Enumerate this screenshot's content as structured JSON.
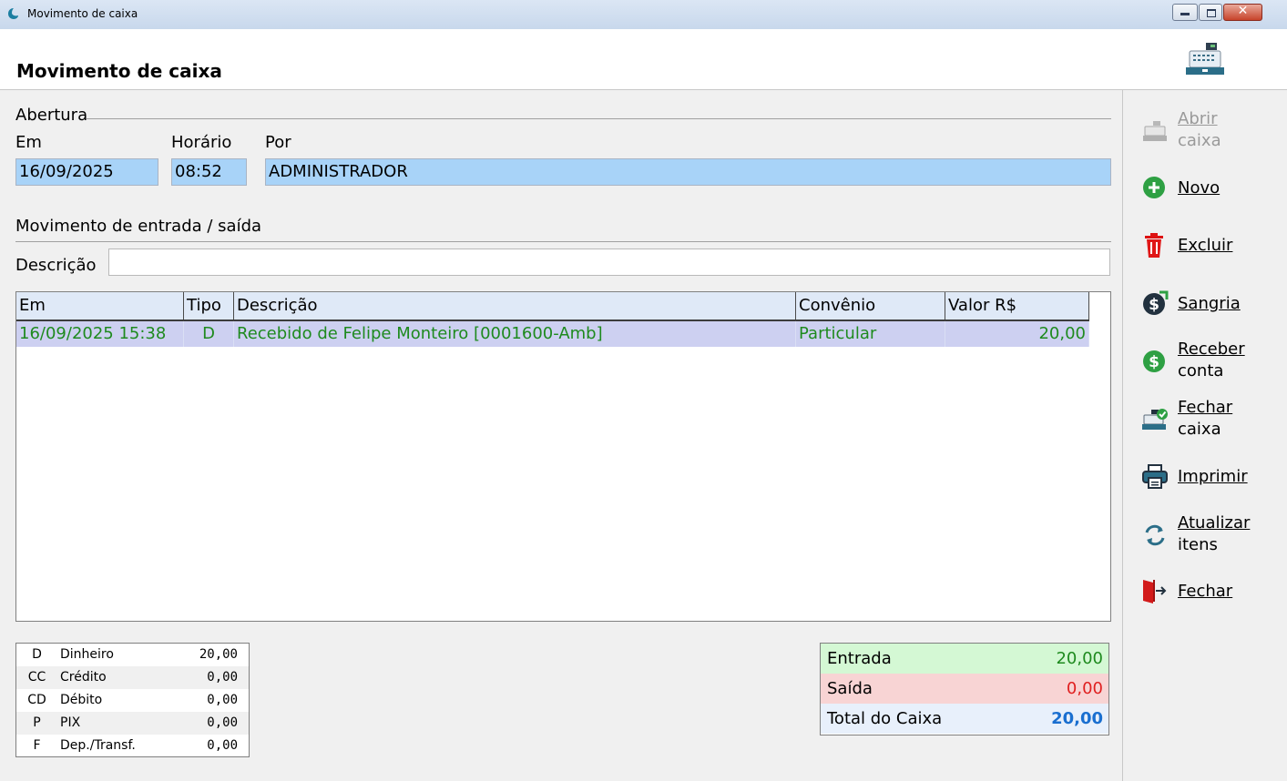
{
  "window": {
    "title": "Movimento de caixa"
  },
  "header": {
    "title": "Movimento de caixa"
  },
  "abertura": {
    "section_label": "Abertura",
    "em_label": "Em",
    "horario_label": "Horário",
    "por_label": "Por",
    "em_value": "16/09/2025",
    "horario_value": "08:52",
    "por_value": "ADMINISTRADOR"
  },
  "movimento": {
    "section_label": "Movimento de entrada / saída",
    "descricao_label": "Descrição",
    "descricao_value": ""
  },
  "grid": {
    "columns": [
      "Em",
      "Tipo",
      "Descrição",
      "Convênio",
      "Valor R$"
    ],
    "rows": [
      {
        "em": "16/09/2025  15:38",
        "tipo": "D",
        "descricao": "Recebido de Felipe Monteiro [0001600-Amb]",
        "convenio": "Particular",
        "valor": "20,00"
      }
    ],
    "row_text_color": "#1e8a1e",
    "row_bg_color": "#cdd0f1"
  },
  "payments": [
    {
      "code": "D",
      "name": "Dinheiro",
      "value": "20,00"
    },
    {
      "code": "CC",
      "name": "Crédito",
      "value": "0,00"
    },
    {
      "code": "CD",
      "name": "Débito",
      "value": "0,00"
    },
    {
      "code": "P",
      "name": "PIX",
      "value": "0,00"
    },
    {
      "code": "F",
      "name": "Dep./Transf.",
      "value": "0,00"
    }
  ],
  "totals": {
    "entrada_label": "Entrada",
    "entrada_value": "20,00",
    "saida_label": "Saída",
    "saida_value": "0,00",
    "total_label": "Total do Caixa",
    "total_value": "20,00"
  },
  "sidebar": {
    "abrir": {
      "line1": "Abrir",
      "line2": "caixa",
      "icon": "cash-register-icon",
      "enabled": false
    },
    "novo": {
      "label": "Novo",
      "icon": "plus-circle-icon"
    },
    "excluir": {
      "label": "Excluir",
      "icon": "trash-icon"
    },
    "sangria": {
      "label": "Sangria",
      "icon": "dollar-out-icon"
    },
    "receber": {
      "line1": "Receber",
      "line2": "conta",
      "icon": "dollar-circle-icon"
    },
    "fechar_caixa": {
      "line1": "Fechar",
      "line2": "caixa",
      "icon": "cash-register-check-icon"
    },
    "imprimir": {
      "label": "Imprimir",
      "icon": "printer-icon"
    },
    "atualizar": {
      "line1": "Atualizar",
      "line2": "itens",
      "icon": "refresh-icon"
    },
    "fechar": {
      "label": "Fechar",
      "icon": "exit-door-icon"
    }
  },
  "colors": {
    "field_bg": "#a8d3f8",
    "entrada_bg": "#d4f8d4",
    "entrada_color": "#1e8a1e",
    "saida_bg": "#f8d4d4",
    "saida_color": "#e02020",
    "total_bg": "#e8f0fb",
    "total_color": "#1a6fd0"
  }
}
